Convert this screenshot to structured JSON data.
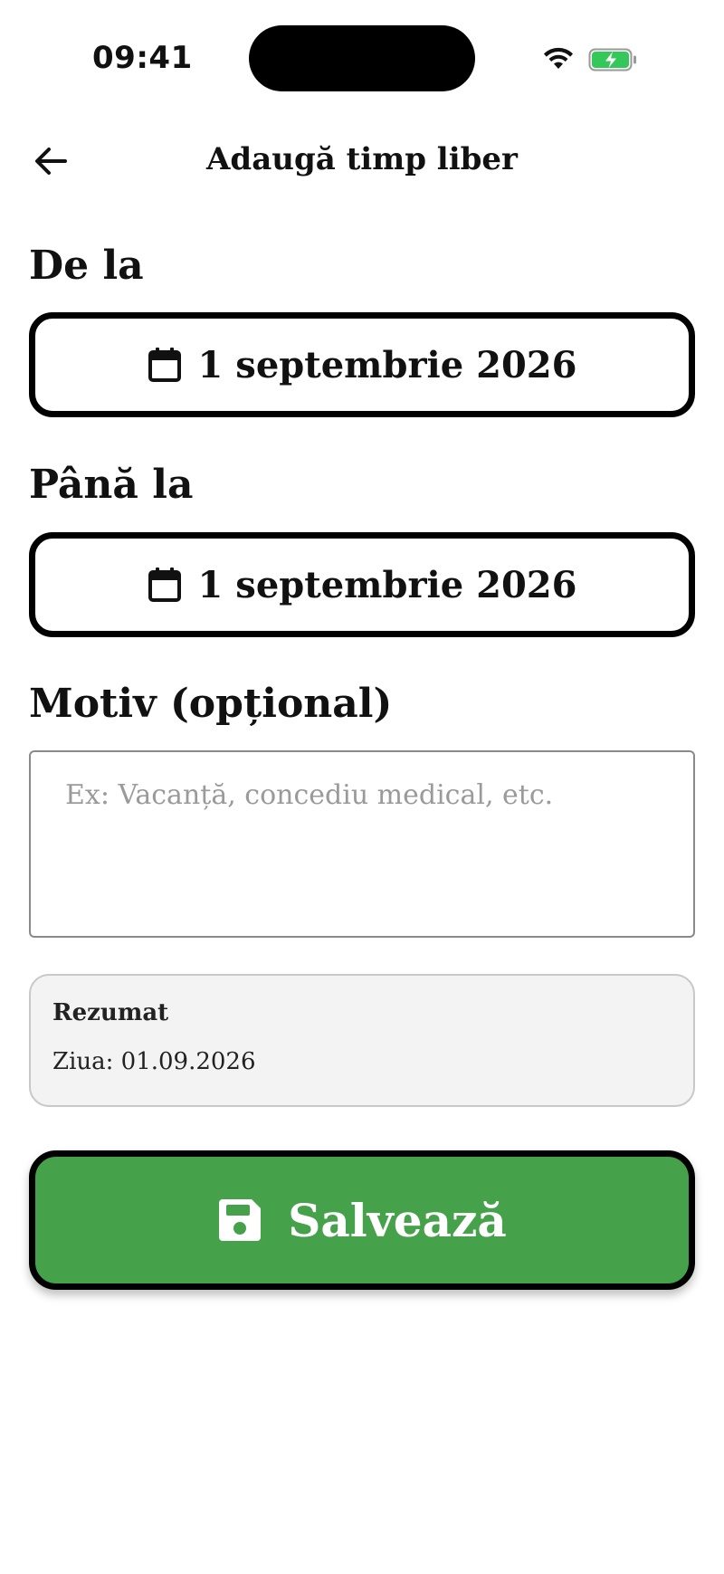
{
  "status_bar": {
    "time": "09:41",
    "wifi_icon": "wifi-icon",
    "battery_icon": "battery-charging-icon",
    "battery_color": "#34c759"
  },
  "header": {
    "back_icon": "arrow-left-icon",
    "title": "Adaugă timp liber"
  },
  "from": {
    "label": "De la",
    "icon": "calendar-icon",
    "value": "1 septembrie 2026"
  },
  "to": {
    "label": "Până la",
    "icon": "calendar-icon",
    "value": "1 septembrie 2026"
  },
  "reason": {
    "label": "Motiv (opțional)",
    "value": "",
    "placeholder": "Ex: Vacanță, concediu medical, etc."
  },
  "summary": {
    "title": "Rezumat",
    "line": "Ziua: 01.09.2026"
  },
  "save_button": {
    "label": "Salvează",
    "icon": "floppy-disk-icon",
    "color": "#46a24a"
  }
}
